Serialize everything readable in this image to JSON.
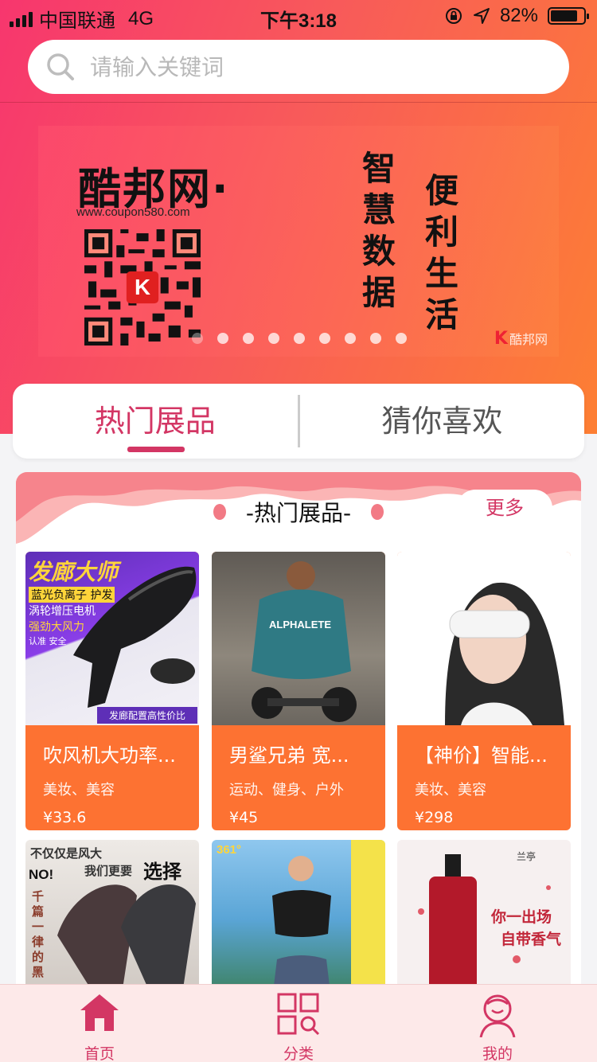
{
  "status_bar": {
    "carrier": "中国联通",
    "network": "4G",
    "time": "下午3:18",
    "battery_percent": "82%",
    "battery_level": 0.82
  },
  "search": {
    "placeholder": "请输入关键词"
  },
  "banner": {
    "brand": "酷邦网·",
    "url": "www.coupon580.com",
    "slogan_1": "智慧数据",
    "slogan_2": "便利生活",
    "logo_text": "酷邦网",
    "logo_letter": "K",
    "dot_count": 9,
    "active_dot": 0
  },
  "tabs": [
    {
      "label": "热门展品",
      "active": true
    },
    {
      "label": "猜你喜欢",
      "active": false
    }
  ],
  "hot_section": {
    "title": "-热门展品-",
    "more_label": "更多",
    "products": [
      {
        "name": "吹风机大功率...",
        "tags": "美妆、美容",
        "price": "¥33.6"
      },
      {
        "name": "男鲨兄弟 宽...",
        "tags": "运动、健身、户外",
        "price": "¥45"
      },
      {
        "name": "【神价】智能...",
        "tags": "美妆、美容",
        "price": "¥298"
      }
    ],
    "image_texts": {
      "dryer_title": "发廊大师",
      "dryer_lines": [
        "蓝光负离子 护发",
        "涡轮增压电机",
        "强劲大风力",
        "认准 安全"
      ],
      "dryer_bottom": "发廊配置高性价比",
      "shirt_text": "ALPHALETE",
      "row2_left_a": "不仅仅是风大",
      "row2_left_b": "我们更要",
      "row2_left_c": "选择",
      "row2_left_d": "NO!",
      "row2_left_e": "千篇一律的黑",
      "row2_mid": "361°",
      "row2_right_a": "兰亭",
      "row2_right_b": "你一出场",
      "row2_right_c": "自带香气"
    }
  },
  "bottom_nav": [
    {
      "label": "首页",
      "icon": "home-icon"
    },
    {
      "label": "分类",
      "icon": "category-icon"
    },
    {
      "label": "我的",
      "icon": "profile-icon"
    }
  ],
  "colors": {
    "accent": "#d33664",
    "card_orange": "#fd7232",
    "gradient_start": "#f7366e",
    "gradient_end": "#fd7f33"
  }
}
